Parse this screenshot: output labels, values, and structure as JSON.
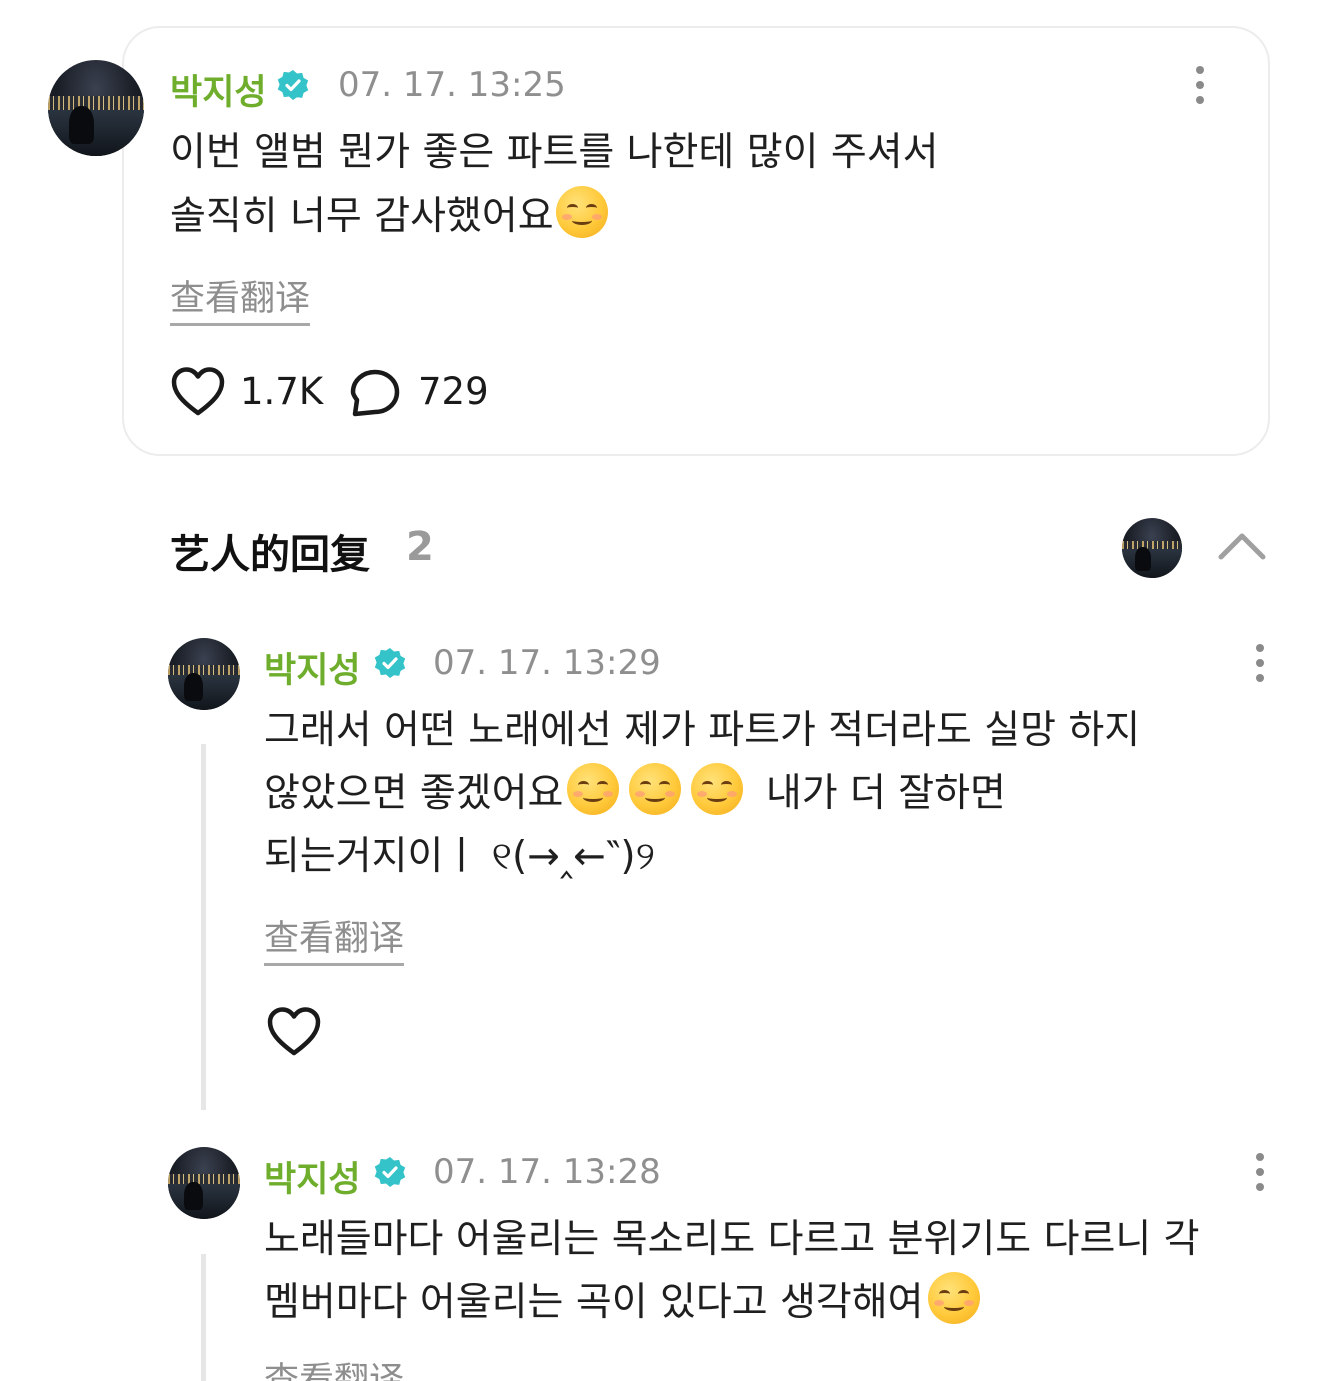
{
  "post": {
    "author": "박지성",
    "timestamp": "07. 17. 13:25",
    "text_lines": [
      "이번 앨범 뭔가 좋은 파트를 나한테 많이 주셔서",
      "솔직히 너무 감사했어요"
    ],
    "translate_label": "查看翻译",
    "likes": "1.7K",
    "comments": "729"
  },
  "replies_section": {
    "title": "艺人的回复",
    "count": "2"
  },
  "replies": [
    {
      "author": "박지성",
      "timestamp": "07. 17. 13:29",
      "line1": "그래서 어떤 노래에선 제가 파트가 적더라도 실망 하지",
      "line2_a": "않았으면 좋겠어요",
      "line2_b": "내가 더 잘하면",
      "line3": "되는거지이ㅣ ୧(→‸←‶)୨",
      "translate_label": "查看翻译"
    },
    {
      "author": "박지성",
      "timestamp": "07. 17. 13:28",
      "line1": "노래들마다 어울리는 목소리도 다르고 분위기도 다르니 각",
      "line2": "멤버마다 어울리는 곡이 있다고 생각해여",
      "translate_label": "查看翻译"
    }
  ],
  "icons": {
    "verified": "verified-badge-icon",
    "emoji": "smiling-face-emoji",
    "like": "heart-icon",
    "comment": "comment-bubble-icon",
    "more": "more-vertical-icon",
    "collapse": "chevron-up-icon"
  },
  "colors": {
    "author_name": "#6fae2c",
    "verified_badge": "#34c3c9",
    "timestamp": "#8f8f8f"
  }
}
